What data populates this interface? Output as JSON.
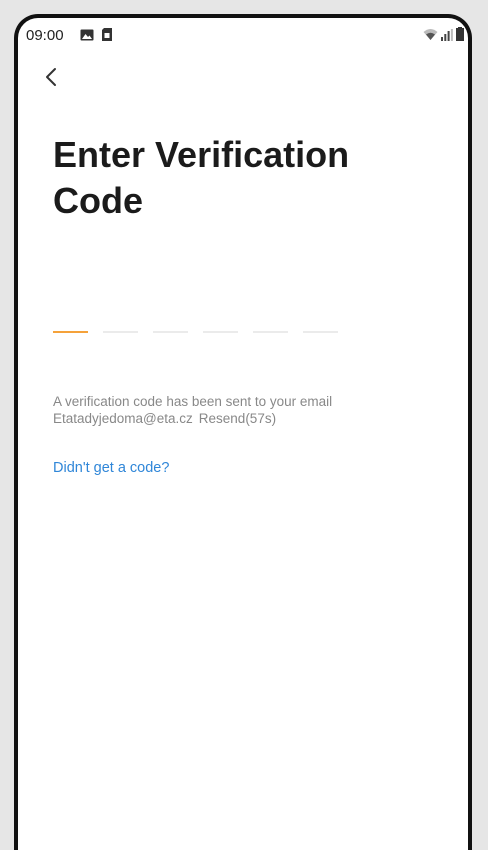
{
  "status_bar": {
    "time": "09:00",
    "icons_left": [
      "gallery-icon",
      "sim-card-icon"
    ],
    "icons_right": [
      "wifi-icon",
      "signal-icon",
      "battery-icon"
    ]
  },
  "nav": {
    "back_icon": "chevron-left-icon"
  },
  "page": {
    "title": "Enter Verification Code",
    "code_slots": 6,
    "active_slot": 1,
    "info_line1": "A verification code has been sent to your email",
    "email": "Etatadyjedoma@eta.cz",
    "resend_label": "Resend(57s)",
    "help_link": "Didn't get a code?"
  },
  "colors": {
    "accent_orange": "#f5a23a",
    "link_blue": "#2f86d8",
    "title_text": "#1b1b1b",
    "muted_text": "#888888"
  }
}
